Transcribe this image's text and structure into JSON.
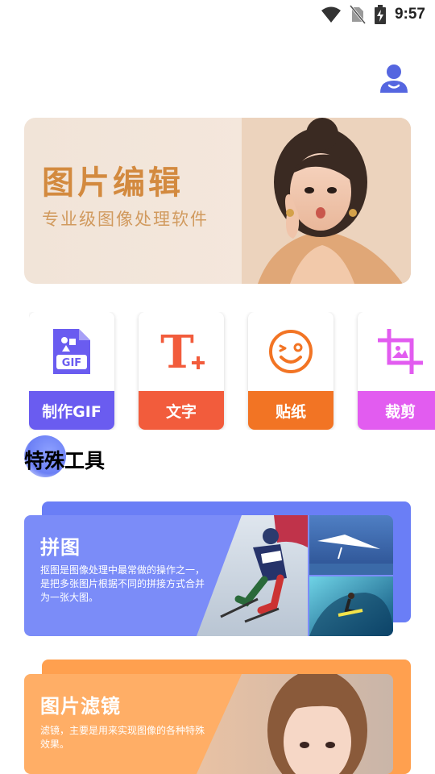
{
  "status_bar": {
    "time": "9:57",
    "icons": [
      "wifi-icon",
      "no-sim-icon",
      "battery-charging-icon"
    ]
  },
  "header": {
    "user_icon": "user-icon"
  },
  "banner": {
    "title": "图片编辑",
    "subtitle": "专业级图像处理软件",
    "colors": {
      "title": "#d38a3f",
      "background": "#f1e4d8"
    }
  },
  "tools": [
    {
      "label": "制作GIF",
      "icon": "gif-file-icon",
      "color": "#6a5cf0"
    },
    {
      "label": "文字",
      "icon": "text-add-icon",
      "color": "#f25c3c"
    },
    {
      "label": "贴纸",
      "icon": "sticker-smile-icon",
      "color": "#f27424"
    },
    {
      "label": "裁剪",
      "icon": "crop-icon",
      "color": "#e25cf0"
    }
  ],
  "section": {
    "title": "特殊工具"
  },
  "features": [
    {
      "title": "拼图",
      "description": "抠图是图像处理中最常做的操作之一，是把多张图片根据不同的拼接方式合并为一张大图。",
      "color": "#7b8cf8"
    },
    {
      "title": "图片滤镜",
      "description": "滤镜，主要是用来实现图像的各种特殊效果。",
      "color": "#ffae66"
    }
  ]
}
